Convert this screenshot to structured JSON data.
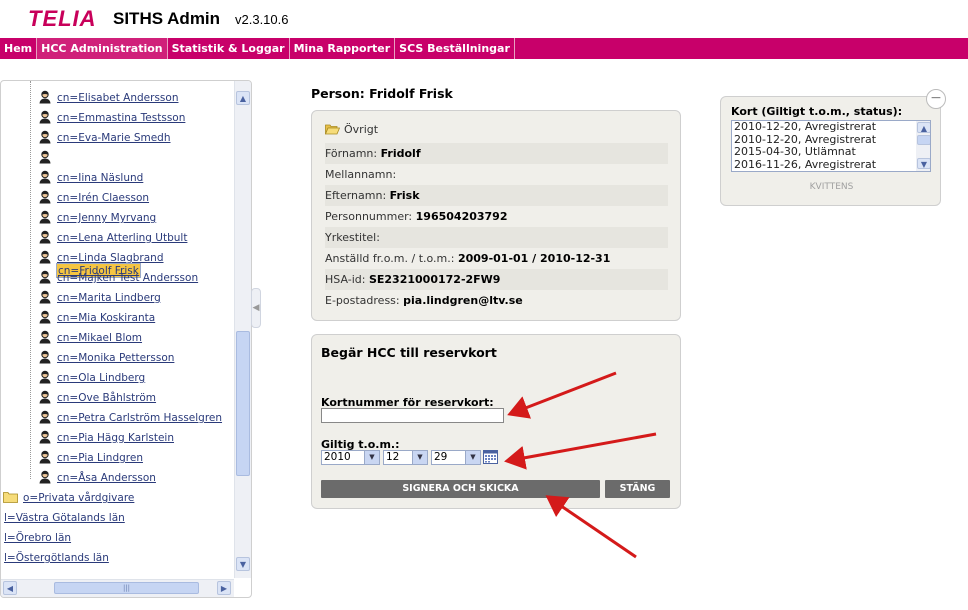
{
  "app": {
    "logo": "TELIA",
    "title": "SITHS Admin",
    "version": "v2.3.10.6"
  },
  "nav": [
    "Hem",
    "HCC Administration",
    "Statistik & Loggar",
    "Mina Rapporter",
    "SCS Beställningar"
  ],
  "tree": {
    "persons": [
      "cn=Elisabet Andersson",
      "cn=Emmastina Testsson",
      "cn=Eva-Marie Smedh",
      "cn=Fridolf Frisk",
      "cn=Iina Näslund",
      "cn=Irén Claesson",
      "cn=Jenny Myrvang",
      "cn=Lena Atterling Utbult",
      "cn=Linda Slagbrand",
      "cn=Majken Test Andersson",
      "cn=Marita Lindberg",
      "cn=Mia Koskiranta",
      "cn=Mikael Blom",
      "cn=Monika Pettersson",
      "cn=Ola Lindberg",
      "cn=Ove Båhlström",
      "cn=Petra Carlström Hasselgren",
      "cn=Pia Hägg Karlstein",
      "cn=Pia Lindgren",
      "cn=Åsa Andersson"
    ],
    "selected_index": 3,
    "folder": "o=Privata vårdgivare",
    "regions": [
      "l=Västra Götalands län",
      "l=Örebro län",
      "l=Östergötlands län"
    ]
  },
  "person": {
    "heading": "Person: Fridolf Frisk",
    "section": "Övrigt",
    "fields": [
      {
        "label": "Förnamn:",
        "value": "Fridolf"
      },
      {
        "label": "Mellannamn:",
        "value": ""
      },
      {
        "label": "Efternamn:",
        "value": "Frisk"
      },
      {
        "label": "Personnummer:",
        "value": "196504203792"
      },
      {
        "label": "Yrkestitel:",
        "value": ""
      },
      {
        "label": "Anställd fr.o.m. / t.o.m.:",
        "value": "2009-01-01 / 2010-12-31"
      },
      {
        "label": "HSA-id:",
        "value": "SE2321000172-2FW9"
      },
      {
        "label": "E-postadress:",
        "value": "pia.lindgren@ltv.se"
      }
    ]
  },
  "request": {
    "title": "Begär HCC till reservkort",
    "card_label": "Kortnummer för reservkort:",
    "card_value": "",
    "valid_label": "Giltig t.o.m.:",
    "year": "2010",
    "month": "12",
    "day": "29",
    "sign_button": "SIGNERA OCH SKICKA",
    "close_button": "STÄNG"
  },
  "cards": {
    "title": "Kort (Giltigt t.o.m., status):",
    "items": [
      "2010-12-20, Avregistrerat",
      "2010-12-20, Avregistrerat",
      "2015-04-30, Utlämnat",
      "2016-11-26, Avregistrerat"
    ],
    "receipt": "KVITTENS"
  },
  "colors": {
    "brand": "#c8006a",
    "arrow": "#d41a1a",
    "button": "#6b6b6b",
    "selected": "#f5c542"
  }
}
